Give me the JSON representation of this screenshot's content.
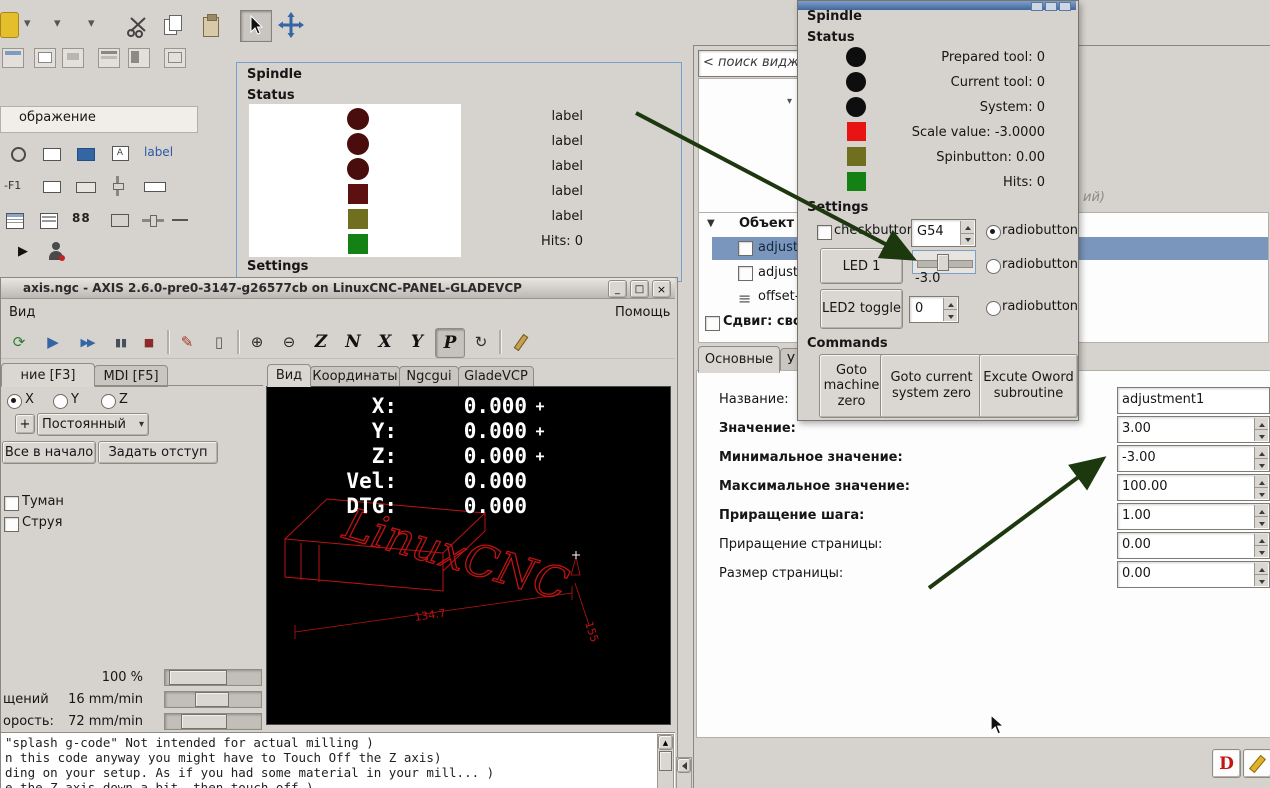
{
  "icons": {
    "chevron_down": "▾",
    "reload": "⟳",
    "run": "▶",
    "fast_forward": "▶▶",
    "pause": "▮▮",
    "stop": "■",
    "edit": "✎",
    "ruler": "▯",
    "zoom_in": "⊕",
    "zoom_out": "⊖",
    "rotate": "↻",
    "play": "▶",
    "list": "≡",
    "expander": "▼",
    "up_arrow": "▲",
    "win_min": "_",
    "win_max": "□",
    "win_close": "×",
    "crosshair": "+"
  },
  "palette": {
    "header": "ображение",
    "icon_label": "label",
    "icon_f1": "-F1",
    "icon_88": "88",
    "icon_a": "A"
  },
  "spindle_preview": {
    "title": "Spindle",
    "status_heading": "Status",
    "settings_heading": "Settings",
    "labels": [
      "label",
      "label",
      "label",
      "label",
      "label"
    ],
    "hits": "Hits: 0"
  },
  "axis": {
    "title": "axis.ngc - AXIS 2.6.0-pre0-3147-g26577cb on LinuxCNC-PANEL-GLADEVCP",
    "menu": {
      "left": "Вид",
      "right": "Помощь"
    },
    "left_tabs": [
      "ние [F3]",
      "MDI [F5]"
    ],
    "axis_radios": [
      "X",
      "Y",
      "Z"
    ],
    "plus_button": "+",
    "jog_combo": "Постоянный",
    "home_button": "Все в начало",
    "offset_button": "Задать отступ",
    "checkboxes": [
      "Туман",
      "Струя"
    ],
    "sliders": [
      {
        "label": "",
        "value": "100 %"
      },
      {
        "label": "щений",
        "value": "16 mm/min"
      },
      {
        "label": "орость:",
        "value": "72 mm/min"
      }
    ],
    "right_tabs": [
      "Вид",
      "Координаты",
      "Ngcgui",
      "GladeVCP"
    ],
    "view_letters": [
      "Z",
      "N",
      "X",
      "Y",
      "P"
    ],
    "dro": [
      {
        "label": "X:",
        "value": "0.000"
      },
      {
        "label": "Y:",
        "value": "0.000"
      },
      {
        "label": "Z:",
        "value": "0.000"
      },
      {
        "label": "Vel:",
        "value": "0.000"
      },
      {
        "label": "DTG:",
        "value": "0.000"
      }
    ],
    "preview_engraving": "LinuxCNC",
    "preview_dims": [
      "134.7",
      "155"
    ],
    "console_lines": [
      "\"splash g-code\" Not intended for actual milling )",
      "n this code anyway you might have to Touch Off the Z axis)",
      "ding on your setup. As if you had some material in your mill... )",
      "e the Z axis down a bit  then touch off )"
    ]
  },
  "glade": {
    "search_text": "< поиск видж",
    "partial_hint": "ий)",
    "tree_root": "Объект",
    "tree_items": [
      "adjust",
      "adjust",
      "offset-l"
    ],
    "shift_label": "Сдвиг: сво",
    "tabs": [
      "Основные",
      "У"
    ],
    "properties": [
      {
        "label": "Название:",
        "value": "adjustment1"
      },
      {
        "label": "Значение:",
        "value": "3.00"
      },
      {
        "label": "Минимальное значение:",
        "value": "-3.00"
      },
      {
        "label": "Максимальное значение:",
        "value": "100.00"
      },
      {
        "label": "Приращение шага:",
        "value": "1.00"
      },
      {
        "label": "Приращение страницы:",
        "value": "0.00"
      },
      {
        "label": "Размер страницы:",
        "value": "0.00"
      }
    ],
    "devhelp_label": "D"
  },
  "spindle_window": {
    "title": "Spindle",
    "status_heading": "Status",
    "settings_heading": "Settings",
    "commands_heading": "Commands",
    "status_lines": [
      "Prepared tool: 0",
      "Current tool: 0",
      "System: 0",
      "Scale value: -3.0000",
      "Spinbutton: 0.00",
      "Hits: 0"
    ],
    "checkbutton_label": "checkbutton",
    "combo_value": "G54",
    "radio_labels": [
      "radiobutton",
      "radiobutton",
      "radiobutton"
    ],
    "led1_button": "LED 1",
    "led2_button": "LED2 toggle",
    "scale_value": "-3.0",
    "spin_value": "0",
    "command_buttons": [
      "Goto machine zero",
      "Goto current system zero",
      "Excute Oword subroutine"
    ]
  },
  "colors": {
    "accent_blue": "#3465a4",
    "selection_blue": "#7b96bd",
    "arrow_green": "#1d380f",
    "led_red": "#e81313",
    "led_olive": "#6f6f1f",
    "led_green": "#148114",
    "led_maroon": "#4a0d0d"
  }
}
